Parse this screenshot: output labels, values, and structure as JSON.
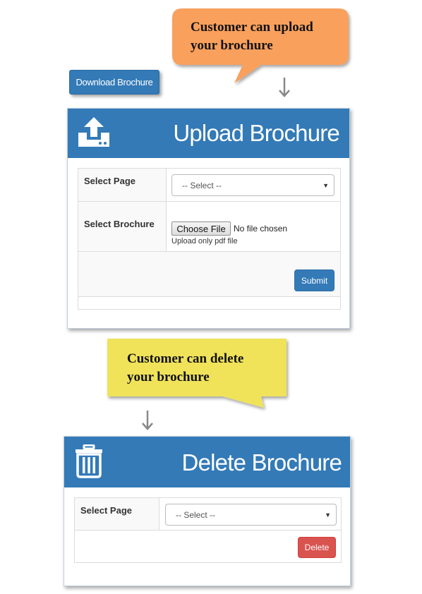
{
  "callouts": {
    "upload": {
      "line1": "Customer can upload",
      "line2": "your brochure",
      "color": "#f9a05b"
    },
    "delete": {
      "line1": "Customer can delete",
      "line2": "your brochure",
      "color": "#f0e35a"
    }
  },
  "download_button": {
    "label": "Download Brochure"
  },
  "upload_panel": {
    "title": "Upload Brochure",
    "icon": "upload-icon",
    "page_label": "Select Page",
    "page_select_value": "-- Select --",
    "brochure_label": "Select Brochure",
    "file_button_label": "Choose File",
    "file_status": "No file chosen",
    "file_help": "Upload only pdf file",
    "submit_label": "Submit"
  },
  "delete_panel": {
    "title": "Delete Brochure",
    "icon": "trash-icon",
    "page_label": "Select Page",
    "page_select_value": "-- Select --",
    "delete_label": "Delete"
  },
  "colors": {
    "primary": "#337ab7",
    "danger": "#d9534f"
  }
}
